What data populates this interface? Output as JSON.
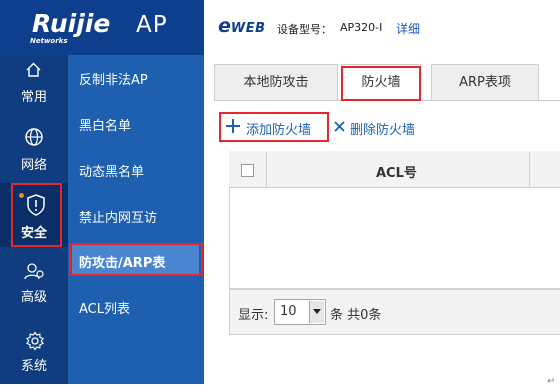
{
  "brand": {
    "logo": "Ruijie",
    "logo_sub": "Networks",
    "product": "AP",
    "eweb": "eWEB"
  },
  "header": {
    "model_label": "设备型号：",
    "model_value": "AP320-I",
    "detail_link": "详细"
  },
  "icon_nav": {
    "items": [
      {
        "label": "常用",
        "icon": "home-icon"
      },
      {
        "label": "网络",
        "icon": "globe-icon"
      },
      {
        "label": "安全",
        "icon": "shield-icon",
        "active": true
      },
      {
        "label": "高级",
        "icon": "users-icon"
      },
      {
        "label": "系统",
        "icon": "gear-icon"
      }
    ]
  },
  "submenu": {
    "items": [
      {
        "label": "反制非法AP"
      },
      {
        "label": "黑白名单"
      },
      {
        "label": "动态黑名单"
      },
      {
        "label": "禁止内网互访"
      },
      {
        "label": "防攻击/ARP表",
        "active": true
      },
      {
        "label": "ACL列表"
      }
    ]
  },
  "tabs": [
    {
      "label": "本地防攻击"
    },
    {
      "label": "防火墙",
      "active": true
    },
    {
      "label": "ARP表项"
    }
  ],
  "toolbar": {
    "add_label": "添加防火墙",
    "delete_label": "删除防火墙"
  },
  "table": {
    "columns": [
      "ACL号"
    ],
    "rows": []
  },
  "pager": {
    "show_label": "显示:",
    "page_size": "10",
    "count_label": "条 共0条"
  },
  "colors": {
    "nav_dark": "#0f3d80",
    "submenu": "#1e5fb0",
    "highlight_red": "#e8262b",
    "link_blue": "#1f5fb5"
  }
}
